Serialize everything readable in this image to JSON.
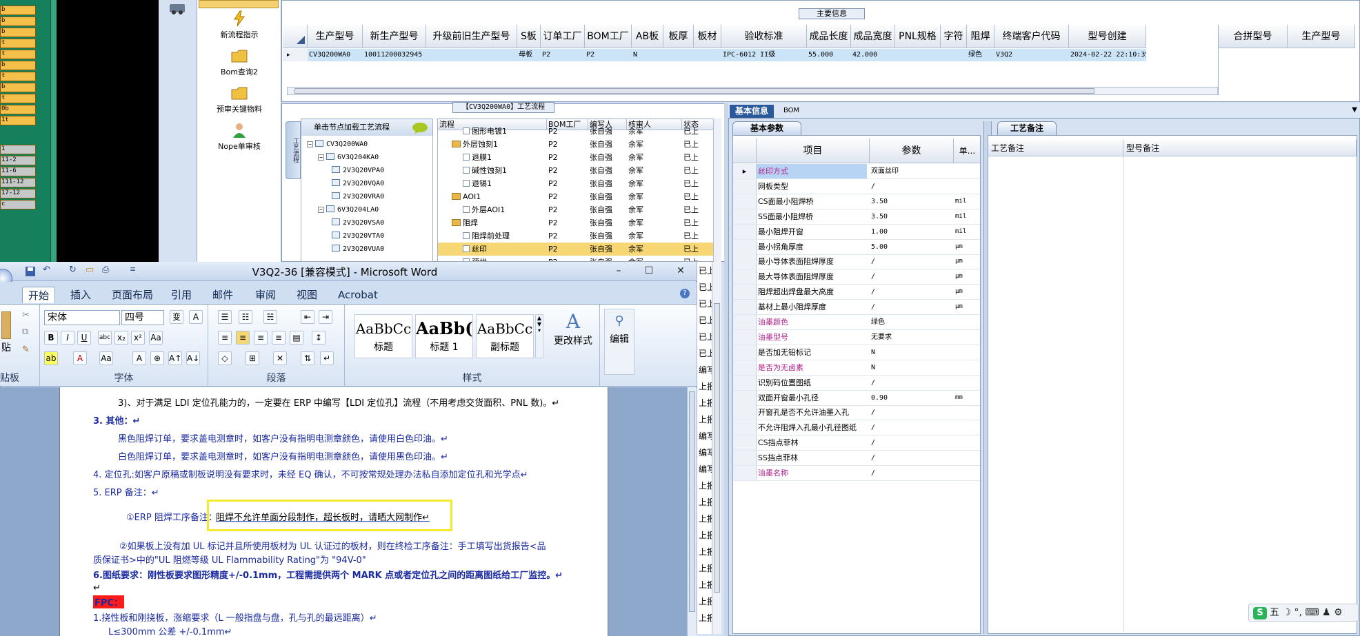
{
  "left_strip": {
    "items": [
      "b",
      "b",
      "b",
      "t",
      "t",
      "b",
      "t",
      "b",
      "t",
      "0b",
      "1t"
    ],
    "items2": [
      "1",
      "11-2",
      "11-6",
      "111-12",
      "17-12",
      "c"
    ]
  },
  "nav": {
    "items": [
      {
        "label": "新流程指示",
        "icon": "lightning-icon"
      },
      {
        "label": "Bom查询2",
        "icon": "folder-icon"
      },
      {
        "label": "预审关键物料",
        "icon": "folder-icon"
      },
      {
        "label": "Nope单审核",
        "icon": "user-icon"
      }
    ]
  },
  "main_info": {
    "title": "主要信息",
    "columns": [
      "生产型号",
      "新生产型号",
      "升级前旧生产型号",
      "S板",
      "订单工厂",
      "BOM工厂",
      "AB板",
      "板厚",
      "板材",
      "验收标准",
      "成品长度",
      "成品宽度",
      "PNL规格",
      "字符",
      "阻焊",
      "终端客户代码",
      "型号创建"
    ],
    "row": [
      "CV3Q200WA0",
      "10011200032945",
      "",
      "母板",
      "P2",
      "P2",
      "N",
      "",
      "",
      "IPC-6012 II级",
      "55.000",
      "42.000",
      "",
      "",
      "绿色",
      "V3Q2",
      "2024-02-22 22:10:35"
    ],
    "right_columns": [
      "合拼型号",
      "生产型号"
    ]
  },
  "process": {
    "title": "【CV3Q200WA0】工艺流程",
    "vertical_tab": "工艺流程",
    "tree_header": "单击节点加载工艺流程",
    "tree": [
      {
        "label": "CV3Q200WA0",
        "level": 0
      },
      {
        "label": "6V3Q204KA0",
        "level": 1
      },
      {
        "label": "2V3Q20VPA0",
        "level": 2
      },
      {
        "label": "2V3Q20VQA0",
        "level": 2
      },
      {
        "label": "2V3Q20VRA0",
        "level": 2
      },
      {
        "label": "6V3Q204LA0",
        "level": 1
      },
      {
        "label": "2V3Q20VSA0",
        "level": 2
      },
      {
        "label": "2V3Q20VTA0",
        "level": 2
      },
      {
        "label": "2V3Q20VUA0",
        "level": 2
      }
    ],
    "flow_columns": [
      "流程",
      "BOM工厂",
      "编写人",
      "核审人",
      "状态"
    ],
    "flow_rows": [
      {
        "name": "图形电镀1",
        "bom": "P2",
        "writer": "张自强",
        "reviewer": "余军",
        "status": "已上",
        "folder": false,
        "indent": 2
      },
      {
        "name": "外层蚀刻1",
        "bom": "P2",
        "writer": "张自强",
        "reviewer": "余军",
        "status": "已上",
        "folder": true,
        "indent": 1
      },
      {
        "name": "退膜1",
        "bom": "P2",
        "writer": "张自强",
        "reviewer": "余军",
        "status": "已上",
        "folder": false,
        "indent": 2
      },
      {
        "name": "碱性蚀刻1",
        "bom": "P2",
        "writer": "张自强",
        "reviewer": "余军",
        "status": "已上",
        "folder": false,
        "indent": 2
      },
      {
        "name": "退锡1",
        "bom": "P2",
        "writer": "张自强",
        "reviewer": "余军",
        "status": "已上",
        "folder": false,
        "indent": 2
      },
      {
        "name": "AOI1",
        "bom": "P2",
        "writer": "张自强",
        "reviewer": "余军",
        "status": "已上",
        "folder": true,
        "indent": 1
      },
      {
        "name": "外层AOI1",
        "bom": "P2",
        "writer": "张自强",
        "reviewer": "余军",
        "status": "已上",
        "folder": false,
        "indent": 2
      },
      {
        "name": "阻焊",
        "bom": "P2",
        "writer": "张自强",
        "reviewer": "余军",
        "status": "已上",
        "folder": true,
        "indent": 1
      },
      {
        "name": "阻焊前处理",
        "bom": "P2",
        "writer": "张自强",
        "reviewer": "余军",
        "status": "已上",
        "folder": false,
        "indent": 2
      },
      {
        "name": "丝印",
        "bom": "P2",
        "writer": "张自强",
        "reviewer": "余军",
        "status": "已上",
        "folder": false,
        "indent": 2,
        "selected": true
      },
      {
        "name": "预烘",
        "bom": "P2",
        "writer": "张自强",
        "reviewer": "余军",
        "status": "已上",
        "folder": false,
        "indent": 2
      }
    ],
    "status_column": [
      "已上",
      "已上",
      "已上",
      "已上",
      "已上",
      "已上",
      "编写",
      "上报",
      "上报",
      "上报",
      "编写",
      "编写",
      "编写",
      "上报",
      "上报",
      "上报",
      "上报",
      "上报",
      "上报",
      "上报",
      "上报",
      "上报"
    ]
  },
  "basic_info": {
    "tabs": [
      "基本信息",
      "BOM"
    ],
    "subtab": "基本参数",
    "columns": [
      "项目",
      "参数",
      "单..."
    ],
    "rows": [
      {
        "item": "丝印方式",
        "value": "双面丝印",
        "unit": "",
        "mag": true,
        "sel": true
      },
      {
        "item": "网板类型",
        "value": "/",
        "unit": ""
      },
      {
        "item": "CS面最小阻焊桥",
        "value": "3.50",
        "unit": "mil"
      },
      {
        "item": "SS面最小阻焊桥",
        "value": "3.50",
        "unit": "mil"
      },
      {
        "item": "最小阻焊开窗",
        "value": "1.00",
        "unit": "mil"
      },
      {
        "item": "最小拐角厚度",
        "value": "5.00",
        "unit": "μm"
      },
      {
        "item": "最小导体表面阻焊厚度",
        "value": "/",
        "unit": "μm"
      },
      {
        "item": "最大导体表面阻焊厚度",
        "value": "/",
        "unit": "μm"
      },
      {
        "item": "阻焊超出焊盘最大高度",
        "value": "/",
        "unit": "μm"
      },
      {
        "item": "基材上最小阻焊厚度",
        "value": "/",
        "unit": "μm"
      },
      {
        "item": "油墨颜色",
        "value": "绿色",
        "unit": "",
        "mag": true
      },
      {
        "item": "油墨型号",
        "value": "无要求",
        "unit": "",
        "mag": true
      },
      {
        "item": "是否加无铅标记",
        "value": "N",
        "unit": ""
      },
      {
        "item": "是否为无卤素",
        "value": "N",
        "unit": "",
        "mag": true
      },
      {
        "item": "识别码位置图纸",
        "value": "/",
        "unit": ""
      },
      {
        "item": "双面开窗最小孔径",
        "value": "0.90",
        "unit": "mm"
      },
      {
        "item": "开窗孔是否不允许油墨入孔",
        "value": "/",
        "unit": ""
      },
      {
        "item": "不允许阻焊入孔最小孔径图纸",
        "value": "/",
        "unit": ""
      },
      {
        "item": "CS挡点菲林",
        "value": "/",
        "unit": ""
      },
      {
        "item": "SS挡点菲林",
        "value": "/",
        "unit": ""
      },
      {
        "item": "油墨名称",
        "value": "/",
        "unit": "",
        "mag": true
      }
    ],
    "notes_tab": "工艺备注",
    "notes_columns": [
      "工艺备注",
      "型号备注"
    ]
  },
  "word": {
    "title": "V3Q2-36 [兼容模式] - Microsoft Word",
    "tabs": [
      "开始",
      "插入",
      "页面布局",
      "引用",
      "邮件",
      "审阅",
      "视图",
      "Acrobat"
    ],
    "font_name": "宋体",
    "font_size": "四号",
    "groups": [
      "贴板",
      "字体",
      "段落",
      "样式"
    ],
    "styles": [
      {
        "preview": "AaBbCc",
        "label": "标题"
      },
      {
        "preview": "AaBb(",
        "label": "标题 1"
      },
      {
        "preview": "AaBbCc",
        "label": "副标题"
      }
    ],
    "change_styles": "更改样式",
    "edit": "编辑",
    "paste": "贴",
    "lines": [
      "3)、对于满足 LDI 定位孔能力的，一定要在 ERP 中编写【LDI 定位孔】流程（不用考虑交货面积、PNL 数)。↵",
      "3. 其他：↵",
      "黑色阻焊订单，要求盖电测章时，如客户没有指明电测章颜色，请使用白色印油。↵",
      "白色阻焊订单，要求盖电测章时，如客户没有指明电测章颜色，请使用黑色印油。↵",
      "4. 定位孔:如客户原稿或制板说明没有要求时，未经 EQ 确认，不可按常规处理办法私自添加定位孔和光学点↵",
      "5. ERP 备注：↵",
      "①ERP 阻焊工序备注：",
      "阻焊不允许单面分段制作，超长板时，请晒大网制作↵",
      "②如果板上没有加 UL 标记并且所使用板材为 UL 认证过的板材，则在终检工序备注：手工填写出货报告<品",
      "质保证书>中的\"UL 阻燃等级 UL Flammability Rating\"为 \"94V-0\"",
      "6.图纸要求：刚性板要求图形精度+/-0.1mm，工程需提供两个 MARK 点或者定位孔之间的距离图纸给工厂监控。↵",
      "↵",
      "FPC：",
      "1.挠性板和刚挠板，涨缩要求（L 一般指盘与盘，孔与孔的最远距离）↵",
      "L≤300mm 公差 +/-0.1mm↵"
    ]
  },
  "ime": {
    "label": "五 ☽ °, ⌨ ♟ ⚙"
  },
  "colors": {
    "accent": "#f4ea2a",
    "brand": "#2b579a",
    "grid_select": "#cce4f8",
    "flow_select": "#f7d774",
    "magenta": "#b0208c"
  }
}
